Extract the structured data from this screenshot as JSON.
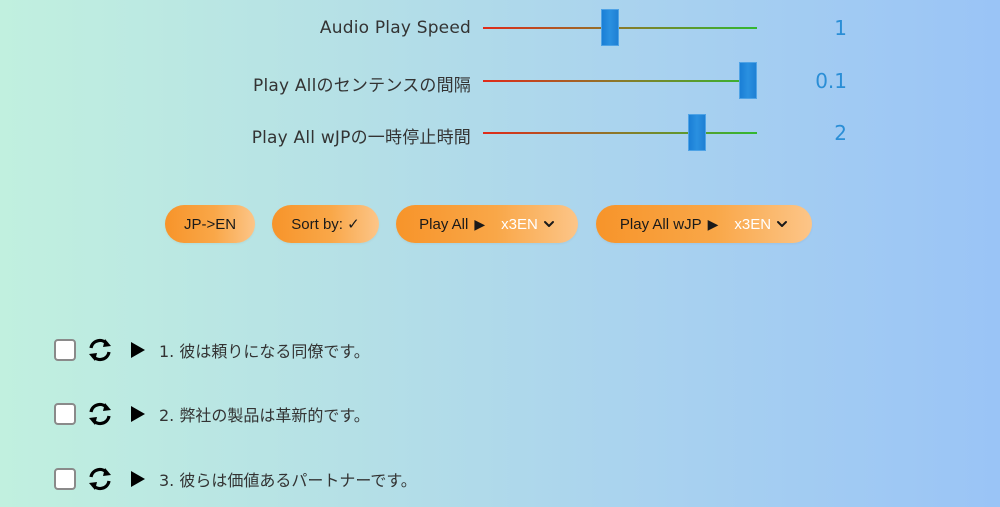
{
  "sliders": [
    {
      "id": "audio-play-speed",
      "label": "Audio Play Speed",
      "value": "1",
      "position": 0.46
    },
    {
      "id": "sentence-interval",
      "label": "Play Allのセンテンスの間隔",
      "value": "0.1",
      "position": 1.0
    },
    {
      "id": "wjp-pause-time",
      "label": "Play All wJPの一時停止時間",
      "value": "2",
      "position": 0.8
    }
  ],
  "buttons": {
    "jp_en": {
      "label": "JP->EN"
    },
    "sort_by": {
      "label": "Sort by: ✓"
    },
    "play_all": {
      "label": "Play All",
      "play_glyph": "▶",
      "option": "x3EN"
    },
    "play_all_wjp": {
      "label": "Play All wJP",
      "play_glyph": "▶",
      "option": "x3EN"
    }
  },
  "items": [
    {
      "text": "1. 彼は頼りになる同僚です。",
      "checked": false
    },
    {
      "text": "2. 弊社の製品は革新的です。",
      "checked": false
    },
    {
      "text": "3. 彼らは価値あるパートナーです。",
      "checked": false
    }
  ],
  "colors": {
    "accent_orange": "#f7942a",
    "slider_thumb": "#1f80d4",
    "value_text": "#2a8ed6"
  }
}
